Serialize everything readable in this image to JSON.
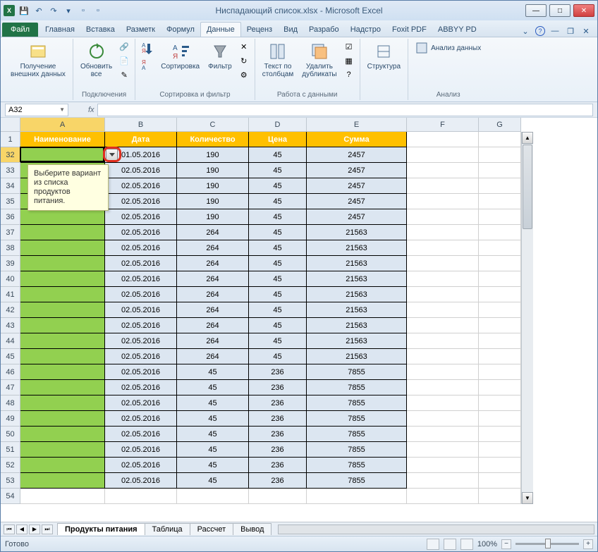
{
  "app": {
    "title": "Ниспадающий список.xlsx - Microsoft Excel"
  },
  "qat": {
    "save": "💾",
    "undo": "↶",
    "redo": "↷"
  },
  "tabs": {
    "file": "Файл",
    "items": [
      "Главная",
      "Вставка",
      "Разметк",
      "Формул",
      "Данные",
      "Реценз",
      "Вид",
      "Разрабо",
      "Надстро",
      "Foxit PDF",
      "ABBYY PD"
    ]
  },
  "ribbon": {
    "ext_data": {
      "label": "Получение\nвнешних данных",
      "btn": "Получение\nвнешних данных"
    },
    "connections": {
      "label": "Подключения",
      "refresh": "Обновить\nвсе"
    },
    "sort_filter": {
      "label": "Сортировка и фильтр",
      "sort": "Сортировка",
      "filter": "Фильтр"
    },
    "data_tools": {
      "label": "Работа с данными",
      "text_cols": "Текст по\nстолбцам",
      "dedupe": "Удалить\nдубликаты"
    },
    "outline": {
      "label": "",
      "structure": "Структура"
    },
    "analysis": {
      "label": "Анализ",
      "btn": "Анализ данных"
    }
  },
  "name_box": "A32",
  "fx": "fx",
  "columns": [
    "A",
    "B",
    "C",
    "D",
    "E",
    "F",
    "G"
  ],
  "header_row": [
    "Наименование",
    "Дата",
    "Количество",
    "Цена",
    "Сумма"
  ],
  "row_nums": [
    1,
    32,
    33,
    34,
    35,
    36,
    37,
    38,
    39,
    40,
    41,
    42,
    43,
    44,
    45,
    46,
    47,
    48,
    49,
    50,
    51,
    52,
    53,
    54
  ],
  "chart_data": {
    "type": "table",
    "columns": [
      "Наименование",
      "Дата",
      "Количество",
      "Цена",
      "Сумма"
    ],
    "rows": [
      [
        "",
        "01.05.2016",
        190,
        45,
        2457
      ],
      [
        "",
        "02.05.2016",
        190,
        45,
        2457
      ],
      [
        "",
        "02.05.2016",
        190,
        45,
        2457
      ],
      [
        "",
        "02.05.2016",
        190,
        45,
        2457
      ],
      [
        "",
        "02.05.2016",
        190,
        45,
        2457
      ],
      [
        "",
        "02.05.2016",
        264,
        45,
        21563
      ],
      [
        "",
        "02.05.2016",
        264,
        45,
        21563
      ],
      [
        "",
        "02.05.2016",
        264,
        45,
        21563
      ],
      [
        "",
        "02.05.2016",
        264,
        45,
        21563
      ],
      [
        "",
        "02.05.2016",
        264,
        45,
        21563
      ],
      [
        "",
        "02.05.2016",
        264,
        45,
        21563
      ],
      [
        "",
        "02.05.2016",
        264,
        45,
        21563
      ],
      [
        "",
        "02.05.2016",
        264,
        45,
        21563
      ],
      [
        "",
        "02.05.2016",
        264,
        45,
        21563
      ],
      [
        "",
        "02.05.2016",
        45,
        236,
        7855
      ],
      [
        "",
        "02.05.2016",
        45,
        236,
        7855
      ],
      [
        "",
        "02.05.2016",
        45,
        236,
        7855
      ],
      [
        "",
        "02.05.2016",
        45,
        236,
        7855
      ],
      [
        "",
        "02.05.2016",
        45,
        236,
        7855
      ],
      [
        "",
        "02.05.2016",
        45,
        236,
        7855
      ],
      [
        "",
        "02.05.2016",
        45,
        236,
        7855
      ],
      [
        "",
        "02.05.2016",
        45,
        236,
        7855
      ]
    ]
  },
  "input_message": "Выберите вариант из списка продуктов питания.",
  "sheets": [
    "Продукты питания",
    "Таблица",
    "Рассчет",
    "Вывод"
  ],
  "status": {
    "ready": "Готово",
    "zoom": "100%"
  }
}
